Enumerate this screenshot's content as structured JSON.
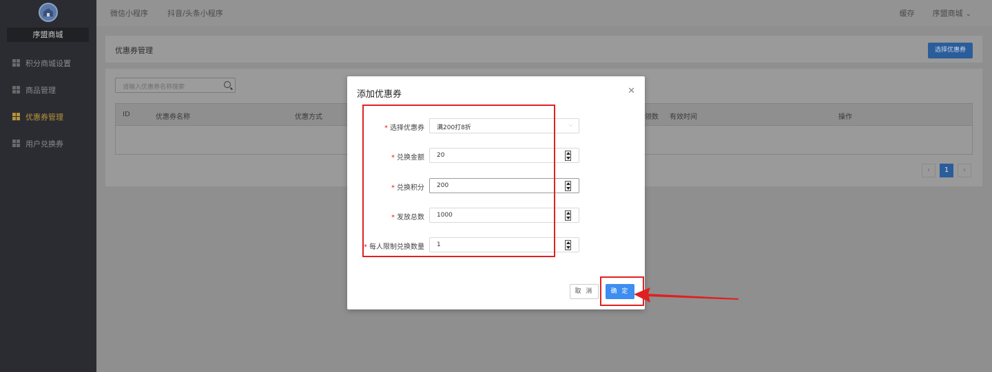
{
  "sidebar": {
    "shop_name": "序盟商城",
    "items": [
      {
        "label": "积分商城设置"
      },
      {
        "label": "商品管理"
      },
      {
        "label": "优惠券管理",
        "active": true
      },
      {
        "label": "用户兑换券"
      }
    ]
  },
  "topbar": {
    "nav": [
      "微信小程序",
      "抖音/头条小程序"
    ],
    "clear_cache": "缓存",
    "shop": "序盟商城"
  },
  "page": {
    "title": "优惠券管理",
    "select_btn": "选择优惠券",
    "search_placeholder": "请输入优惠券名称搜索",
    "columns": [
      "ID",
      "优惠券名称",
      "优惠方式",
      "领数",
      "有效时间",
      "操作"
    ],
    "current_page": "1"
  },
  "modal": {
    "title": "添加优惠券",
    "fields": [
      {
        "label": "选择优惠券",
        "value": "满200打8折"
      },
      {
        "label": "兑换金额",
        "value": "20"
      },
      {
        "label": "兑换积分",
        "value": "200"
      },
      {
        "label": "发放总数",
        "value": "1000"
      },
      {
        "label": "每人限制兑换数量",
        "value": "1"
      }
    ],
    "cancel": "取 消",
    "ok": "确 定"
  },
  "colors": {
    "primary": "#3d8ef0",
    "highlight": "#e02020",
    "active_menu": "#b8923c"
  }
}
